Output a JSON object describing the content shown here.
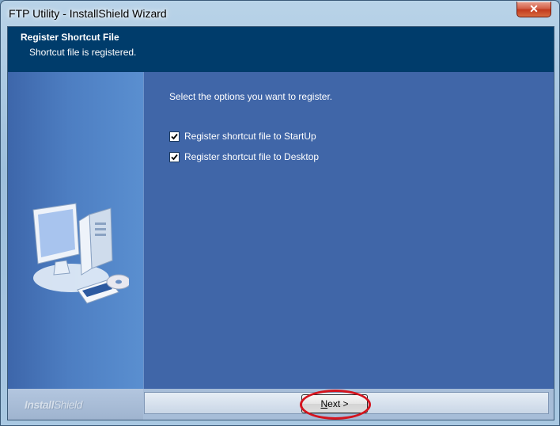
{
  "window": {
    "title": "FTP Utility - InstallShield Wizard"
  },
  "header": {
    "title": "Register Shortcut File",
    "subtitle": "Shortcut file is registered."
  },
  "main": {
    "prompt": "Select the options you want to register.",
    "options": [
      {
        "label": "Register shortcut file to StartUp",
        "checked": true
      },
      {
        "label": "Register shortcut file to Desktop",
        "checked": true
      }
    ]
  },
  "footer": {
    "brand_primary": "Install",
    "brand_secondary": "Shield",
    "next_mnemonic": "N",
    "next_rest": "ext >"
  },
  "colors": {
    "header": "#003c6b",
    "panel": "#4066a8",
    "highlight": "#d4141e"
  }
}
